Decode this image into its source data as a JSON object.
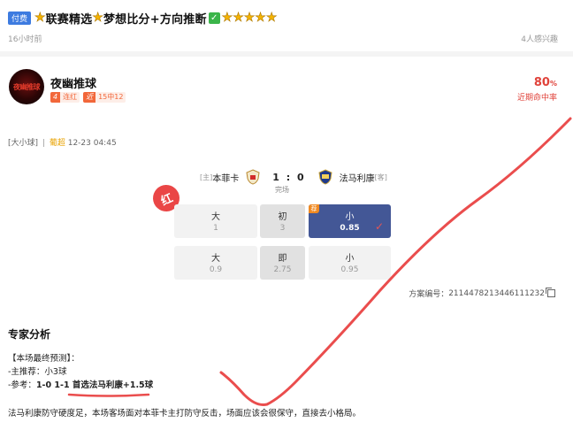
{
  "header": {
    "paid_tag": "付费",
    "title_part1": "联赛精选",
    "title_part2": "梦想比分+方向推断",
    "time_ago": "16小时前",
    "viewers": "4人感兴趣"
  },
  "author": {
    "avatar_text": "夜幽推球",
    "name": "夜幽推球",
    "streak_icon": "4",
    "streak_text": "连红",
    "recent_icon": "近",
    "recent_text": "15中12",
    "hit_rate_value": "80",
    "hit_rate_unit": "%",
    "hit_rate_label": "近期命中率"
  },
  "market": {
    "type": "[大小球]",
    "league": "葡超",
    "datetime": "12-23 04:45"
  },
  "match": {
    "home_tag": "[主]",
    "home_team": "本菲卡",
    "score": "1 : 0",
    "away_team": "法马利康",
    "away_tag": "[客]",
    "status": "完场",
    "result_bubble": "红"
  },
  "odds": {
    "row1": {
      "left_label": "大",
      "left_value": "1",
      "mid_label": "初",
      "mid_value": "3",
      "right_label": "小",
      "right_value": "0.85",
      "corner_tag": "荐"
    },
    "row2": {
      "left_label": "大",
      "left_value": "0.9",
      "mid_label": "即",
      "mid_value": "2.75",
      "right_label": "小",
      "right_value": "0.95"
    }
  },
  "plan": {
    "label": "方案编号：",
    "number": "2114478213446111232"
  },
  "analysis": {
    "title": "专家分析",
    "line1": "【本场最终预测】：",
    "line2": "-主推荐：小3球",
    "line3_prefix": "-参考：",
    "line3_bold": "1-0 1-1 首选法马利康+1.5球",
    "summary": "法马利康防守硬度足，本场客场面对本菲卡主打防守反击，场面应该会很保守，直接去小格局。"
  },
  "colors": {
    "accent_blue": "#435796",
    "red": "#e0433b",
    "annotation_red": "#ea4d4d",
    "orange": "#f2673a"
  }
}
